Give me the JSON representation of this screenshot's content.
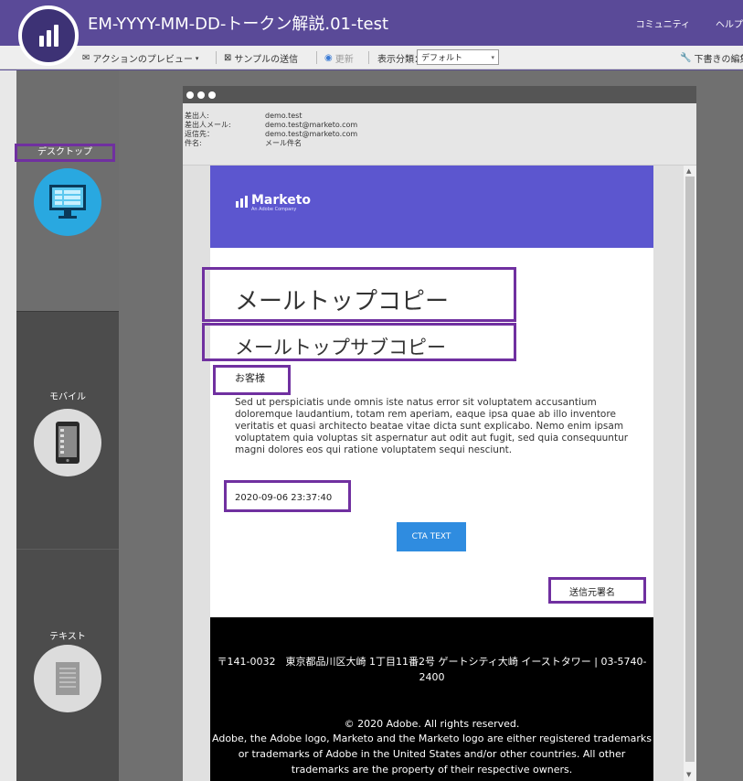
{
  "app": {
    "title": "EM-YYYY-MM-DD-トークン解説.01-test",
    "nav_community": "コミュニティ",
    "nav_help": "ヘルプ"
  },
  "toolbar": {
    "preview_actions": "アクションのプレビュー",
    "send_sample": "サンプルの送信",
    "refresh": "更新",
    "view_label": "表示分類：",
    "view_value": "デフォルト",
    "edit_draft": "下書きの編集"
  },
  "left_panel": {
    "desktop_label": "デスクトップ",
    "mobile_label": "モバイル",
    "text_label": "テキスト"
  },
  "email_header": {
    "from_label": "差出人:",
    "from_value": "demo.test",
    "from_email_label": "差出人メール:",
    "from_email_value": "demo.test@marketo.com",
    "reply_to_label": "返信先：",
    "reply_to_value": "demo.test@marketo.com",
    "subject_label": "件名:",
    "subject_value": "メール件名"
  },
  "email": {
    "brand_name": "Marketo",
    "brand_sub": "An Adobe Company",
    "top_copy": "メールトップコピー",
    "sub_copy": "メールトップサブコピー",
    "salutation": "お客様",
    "body": "Sed ut perspiciatis unde omnis iste natus error sit voluptatem accusantium doloremque laudantium, totam rem aperiam, eaque ipsa quae ab illo inventore veritatis et quasi architecto beatae vitae dicta sunt explicabo. Nemo enim ipsam voluptatem quia voluptas sit aspernatur aut odit aut fugit, sed quia consequuntur magni dolores eos qui ratione voluptatem sequi nesciunt.",
    "date": "2020-09-06 23:37:40",
    "cta": "CTA TEXT",
    "signature": "送信元署名",
    "footer_address": "〒141-0032　東京都品川区大崎 1丁目11番2号 ゲートシティ大崎 イーストタワー | 03-5740-2400",
    "footer_copyright": "© 2020 Adobe. All rights reserved.",
    "footer_legal": "Adobe, the Adobe logo, Marketo and the Marketo logo are either registered trademarks or trademarks of Adobe in the United States and/or other countries. All other trademarks are the property of their respective owners."
  },
  "colors": {
    "header": "#5a4a98",
    "banner": "#5c56cf",
    "highlight": "#7030a0",
    "cta": "#2f8ce0"
  },
  "icons": [
    "marketo-logo-icon",
    "envelope-icon",
    "send-icon",
    "refresh-icon",
    "dropdown-arrow-icon",
    "wrench-icon",
    "desktop-icon",
    "mobile-icon",
    "text-document-icon"
  ]
}
